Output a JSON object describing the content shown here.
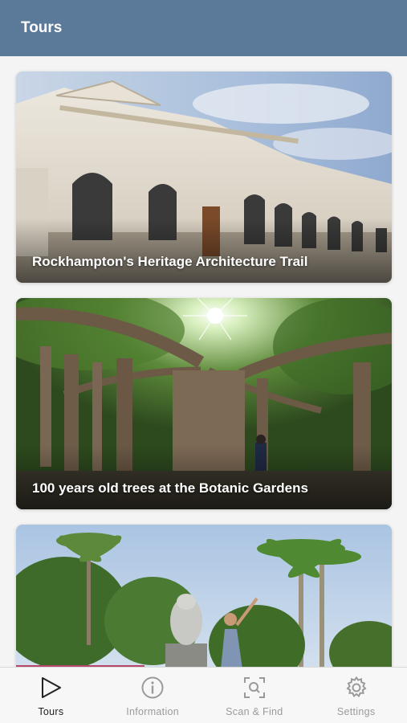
{
  "header": {
    "title": "Tours"
  },
  "tours": [
    {
      "title": "Rockhampton's Heritage Architecture Trail"
    },
    {
      "title": "100 years old trees at the Botanic Gardens"
    },
    {
      "title": ""
    }
  ],
  "tab_bar": {
    "tabs": [
      {
        "label": "Tours",
        "icon": "play-icon",
        "active": true
      },
      {
        "label": "Information",
        "icon": "info-icon",
        "active": false
      },
      {
        "label": "Scan & Find",
        "icon": "scan-icon",
        "active": false
      },
      {
        "label": "Settings",
        "icon": "gear-icon",
        "active": false
      }
    ]
  },
  "colors": {
    "header": "#5b7a9a",
    "tab_active": "#222222",
    "tab_inactive": "#9a9a9a"
  }
}
